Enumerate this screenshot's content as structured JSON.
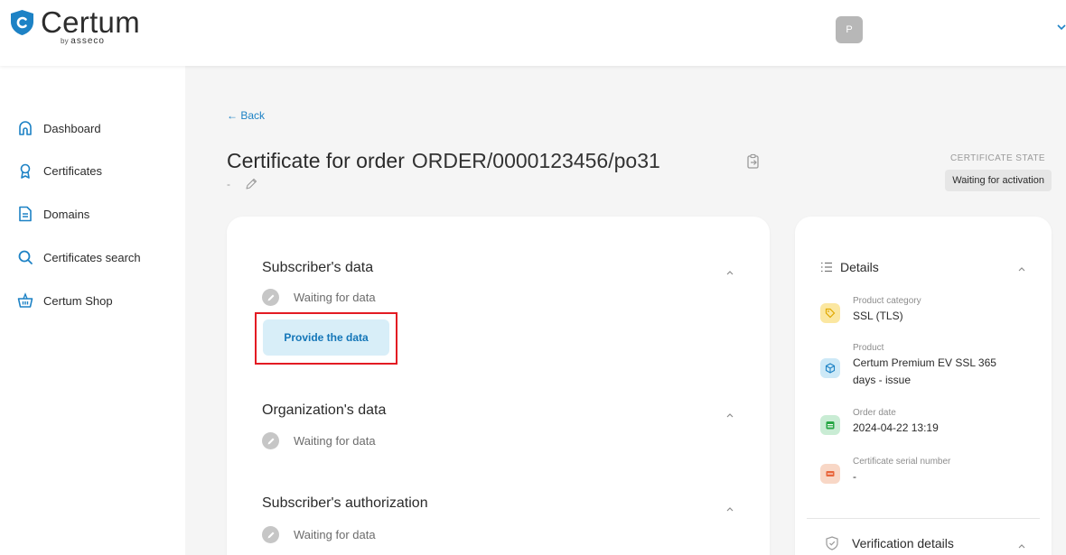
{
  "header": {
    "brand": "Certum",
    "brand_by": "by",
    "brand_parent": "asseco",
    "avatar_initial": "P"
  },
  "sidebar": {
    "items": [
      {
        "label": "Dashboard",
        "icon": "home-icon"
      },
      {
        "label": "Certificates",
        "icon": "award-icon"
      },
      {
        "label": "Domains",
        "icon": "document-icon"
      },
      {
        "label": "Certificates search",
        "icon": "search-icon"
      },
      {
        "label": "Certum Shop",
        "icon": "basket-icon"
      }
    ]
  },
  "main": {
    "back_label": "← Back",
    "title_prefix": "Certificate for order",
    "order_number": "ORDER/0000123456/po31",
    "subtitle": "-",
    "state_label": "CERTIFICATE STATE",
    "state_value": "Waiting for activation",
    "sections": [
      {
        "title": "Subscriber's data",
        "status": "Waiting for data",
        "action": "Provide the data"
      },
      {
        "title": "Organization's data",
        "status": "Waiting for data"
      },
      {
        "title": "Subscriber's authorization",
        "status": "Waiting for data"
      }
    ]
  },
  "details": {
    "title": "Details",
    "items": [
      {
        "label": "Product category",
        "value": "SSL (TLS)",
        "icon": "tag-icon",
        "color": "#fbe7a1"
      },
      {
        "label": "Product",
        "value": "Certum Premium EV SSL 365 days - issue",
        "icon": "cube-icon",
        "color": "#cde9f7"
      },
      {
        "label": "Order date",
        "value": "2024-04-22 13:19",
        "icon": "calendar-icon",
        "color": "#c9ecd4"
      },
      {
        "label": "Certificate serial number",
        "value": "-",
        "icon": "serial-icon",
        "color": "#f8d7c6"
      }
    ],
    "verification_title": "Verification details"
  },
  "colors": {
    "accent": "#1d82c5",
    "highlight": "#e31b23"
  }
}
